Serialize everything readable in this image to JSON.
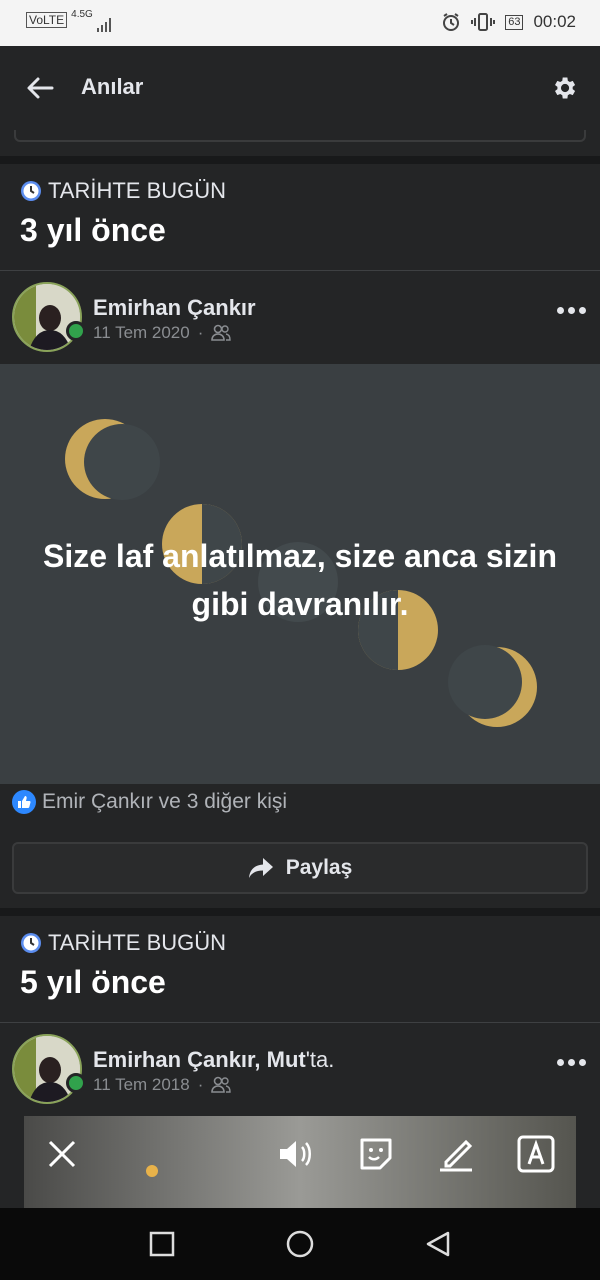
{
  "status_bar": {
    "volte": "VoLTE",
    "network": "4.5G",
    "battery": "63",
    "time": "00:02"
  },
  "header": {
    "title": "Anılar"
  },
  "memories": [
    {
      "section_label": "TARİHTE BUGÜN",
      "years_ago": "3 yıl önce",
      "author": "Emirhan Çankır",
      "location_suffix": "",
      "date": "11 Tem 2020",
      "quote": "Size laf anlatılmaz, size anca sizin gibi davranılır.",
      "reactions": "Emir Çankır ve 3 diğer kişi",
      "share_label": "Paylaş"
    },
    {
      "section_label": "TARİHTE BUGÜN",
      "years_ago": "5 yıl önce",
      "author": "Emirhan Çankır, ",
      "location": "Mut",
      "location_suffix": "'ta.",
      "date": "11 Tem 2018"
    }
  ],
  "colors": {
    "background": "#18191a",
    "card": "#242526",
    "accent_blue": "#2d88ff",
    "online_green": "#31a24c",
    "moon_gold": "#c9a75a"
  }
}
